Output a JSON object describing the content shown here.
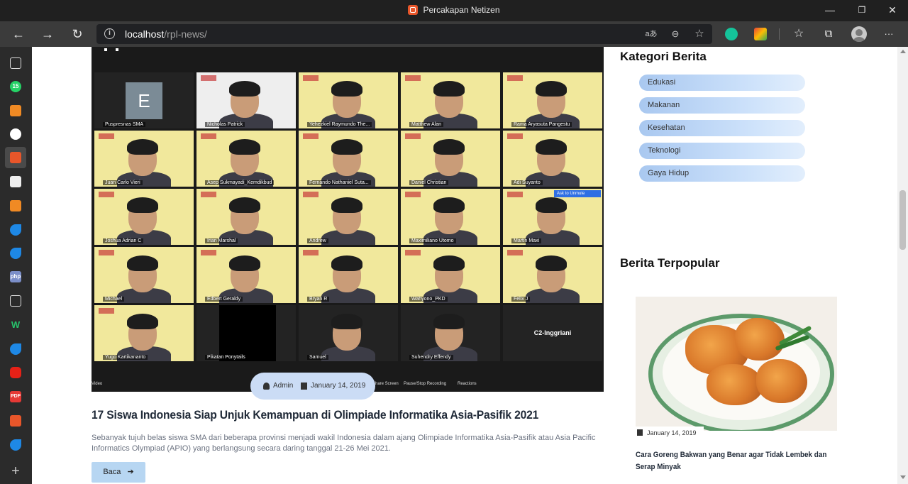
{
  "window": {
    "title": "Percakapan Netizen",
    "controls": {
      "minimize": "—",
      "restore": "❐",
      "close": "✕"
    }
  },
  "toolbar": {
    "back": "←",
    "forward": "→",
    "reload": "↻",
    "info": "i",
    "url_host": "localhost",
    "url_path": "/rpl-news/",
    "read_aloud": "aあ",
    "zoom": "⊖",
    "favorite_add": "☆",
    "favorites": "☆",
    "collections": "⧉",
    "more": "···"
  },
  "sidebar": {
    "icons": [
      "tab-actions-icon",
      "whatsapp-icon",
      "app-icon",
      "github-icon",
      "app-icon",
      "notion-icon",
      "app-icon",
      "bing-icon",
      "bing-icon",
      "php-icon",
      "document-icon",
      "w-icon",
      "bing-icon",
      "youtube-icon",
      "pdf-icon",
      "app-icon",
      "bing-icon",
      "add-icon"
    ],
    "whatsapp_badge": "15",
    "php_label": "php",
    "pdf_label": "PDF",
    "w_label": "W",
    "add_label": "+"
  },
  "zoom_call": {
    "tiles": [
      {
        "name": "Puspresnas SMA",
        "letter": "E"
      },
      {
        "name": "Nicholas Patrick"
      },
      {
        "name": "Yehezkiel Raymundo The..."
      },
      {
        "name": "Matthew Alan"
      },
      {
        "name": "Rama Aryasuta Pangestu"
      },
      {
        "name": "Juan Carlo Vieri"
      },
      {
        "name": "Asep Sukmayadi_Kemdikbud"
      },
      {
        "name": "Fernando Nathaniel Suta..."
      },
      {
        "name": "Daniel Christian"
      },
      {
        "name": "Adi Suyanto"
      },
      {
        "name": "Joshua Adrian C"
      },
      {
        "name": "Irian Marshal"
      },
      {
        "name": "Andrew"
      },
      {
        "name": "Maximiliano Utomo"
      },
      {
        "name": "Martin Maxi"
      },
      {
        "name": "Michael"
      },
      {
        "name": "Edbert Geraldy"
      },
      {
        "name": "Bryan R"
      },
      {
        "name": "Wahyono_PKD"
      },
      {
        "name": "Felix J"
      },
      {
        "name": "Yugo Kartikananto"
      },
      {
        "name": "Pikatan Ponytails"
      },
      {
        "name": "Samuel"
      },
      {
        "name": "Suhendry Effendy"
      },
      {
        "name": "",
        "label": "C2-Inggriani"
      }
    ],
    "bar": {
      "video": "Video",
      "share": "Share Screen",
      "record": "Pause/Stop Recording",
      "reactions": "Reactions"
    },
    "unmute": "Ask to Unmute"
  },
  "article": {
    "author": "Admin",
    "date": "January 14, 2019",
    "title": "17 Siswa Indonesia Siap Unjuk Kemampuan di Olimpiade Informatika Asia-Pasifik 2021",
    "description": "Sebanyak tujuh belas siswa SMA dari beberapa provinsi menjadi wakil Indonesia dalam ajang Olimpiade Informatika Asia-Pasifik atau Asia Pacific Informatics Olympiad (APIO) yang berlangsung secara daring tanggal 21-26 Mei 2021.",
    "read_button": "Baca",
    "read_arrow": "➔"
  },
  "sidebar_right": {
    "categories_heading": "Kategori Berita",
    "categories": [
      "Edukasi",
      "Makanan",
      "Kesehatan",
      "Teknologi",
      "Gaya Hidup"
    ],
    "popular_heading": "Berita Terpopular",
    "popular": {
      "date": "January 14, 2019",
      "title": "Cara Goreng Bakwan yang Benar agar Tidak Lembek dan Serap Minyak"
    }
  },
  "colors": {
    "titlebar": "#202020",
    "toolbar": "#3b3b3b",
    "sidebar": "#2b2b2b",
    "category_pill": "#a9c8f0",
    "button": "#b7d6f2",
    "meta_pill": "#cbdcf5"
  }
}
